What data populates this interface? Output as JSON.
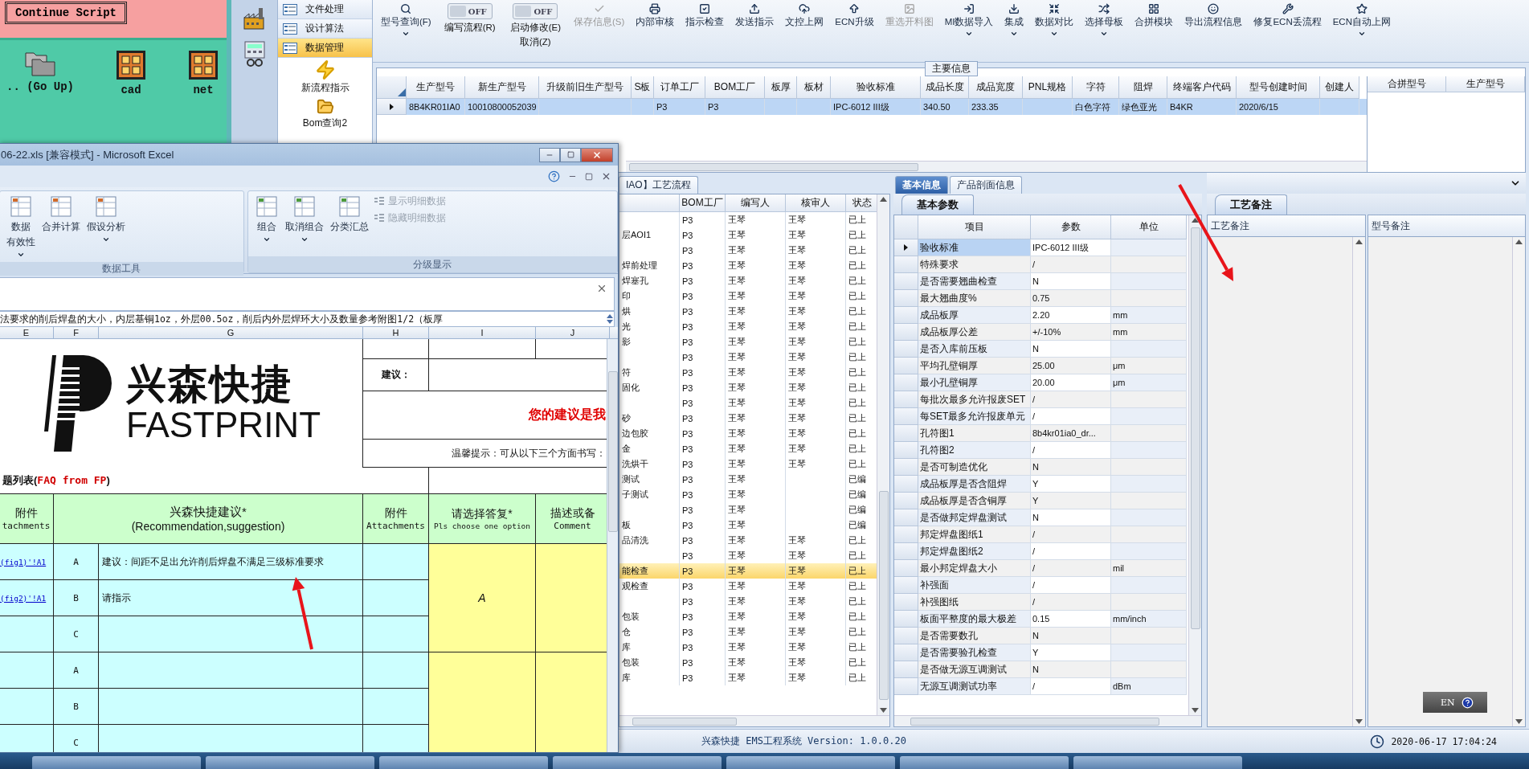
{
  "file_panel": {
    "button": "Continue Script",
    "items": [
      {
        "label": ".. (Go Up)",
        "kind": "folder"
      },
      {
        "label": "cad",
        "kind": "app"
      },
      {
        "label": "net",
        "kind": "app"
      }
    ]
  },
  "ems": {
    "nav": [
      {
        "label": "文件处理",
        "kind": "list",
        "selected": false
      },
      {
        "label": "设计算法",
        "kind": "list",
        "selected": false
      },
      {
        "label": "数据管理",
        "kind": "list",
        "selected": true
      },
      {
        "label": "新流程指示",
        "kind": "bolt",
        "selected": false
      },
      {
        "label": "Bom查询2",
        "kind": "folder",
        "selected": false
      }
    ],
    "toolbar": [
      {
        "kind": "button",
        "label": "型号查询(F)",
        "dropdown": true,
        "disabled": false
      },
      {
        "kind": "toggle",
        "label": "编写流程(R)",
        "state": "OFF",
        "on": false
      },
      {
        "kind": "toggle",
        "label": "启动修改(E)",
        "sublabel": "取消(Z)",
        "state": "OFF",
        "on": false
      },
      {
        "kind": "button",
        "label": "保存信息(S)",
        "dropdown": false,
        "disabled": true
      },
      {
        "kind": "button",
        "label": "内部审核",
        "dropdown": false,
        "disabled": false
      },
      {
        "kind": "button",
        "label": "指示检查",
        "dropdown": false,
        "disabled": false
      },
      {
        "kind": "button",
        "label": "发送指示",
        "dropdown": false,
        "disabled": false
      },
      {
        "kind": "button",
        "label": "文控上网",
        "dropdown": false,
        "disabled": false
      },
      {
        "kind": "button",
        "label": "ECN升级",
        "dropdown": false,
        "disabled": false
      },
      {
        "kind": "button",
        "label": "重选开料图",
        "dropdown": false,
        "disabled": true
      },
      {
        "kind": "button",
        "label": "MI数据导入",
        "dropdown": true,
        "disabled": false
      },
      {
        "kind": "button",
        "label": "集成",
        "dropdown": true,
        "disabled": false
      },
      {
        "kind": "button",
        "label": "数据对比",
        "dropdown": true,
        "disabled": false
      },
      {
        "kind": "button",
        "label": "选择母板",
        "dropdown": true,
        "disabled": false
      },
      {
        "kind": "button",
        "label": "合拼模块",
        "dropdown": false,
        "disabled": false
      },
      {
        "kind": "button",
        "label": "导出流程信息",
        "dropdown": false,
        "disabled": false
      },
      {
        "kind": "button",
        "label": "修复ECN丢流程",
        "dropdown": false,
        "disabled": false
      },
      {
        "kind": "button",
        "label": "ECN自动上网",
        "dropdown": true,
        "disabled": false
      }
    ],
    "main_info": {
      "title": "主要信息",
      "columns": [
        "生产型号",
        "新生产型号",
        "升级前旧生产型号",
        "S板",
        "订单工厂",
        "BOM工厂",
        "板厚",
        "板材",
        "验收标准",
        "成品长度",
        "成品宽度",
        "PNL规格",
        "字符",
        "阻焊",
        "终端客户代码",
        "型号创建时间",
        "创建人"
      ],
      "rows": [
        {
          "selected": true,
          "cells": [
            "8B4KR01IA0",
            "10010800052039",
            "",
            "",
            "P3",
            "P3",
            "",
            "",
            "IPC-6012 III级",
            "340.50",
            "233.35",
            "",
            "白色字符",
            "绿色亚光",
            "B4KR",
            "2020/6/15",
            ""
          ]
        }
      ],
      "side_columns": [
        "合拼型号",
        "生产型号"
      ]
    },
    "process": {
      "tab": "IAO】工艺流程",
      "columns": [
        "BOM工厂",
        "编写人",
        "核审人",
        "状态"
      ],
      "rows": [
        {
          "step": "",
          "factory": "P3",
          "writer": "王琴",
          "reviewer": "王琴",
          "status": "已上",
          "selected": false
        },
        {
          "step": "层AOI1",
          "factory": "P3",
          "writer": "王琴",
          "reviewer": "王琴",
          "status": "已上",
          "selected": false
        },
        {
          "step": "",
          "factory": "P3",
          "writer": "王琴",
          "reviewer": "王琴",
          "status": "已上",
          "selected": false
        },
        {
          "step": "焊前处理",
          "factory": "P3",
          "writer": "王琴",
          "reviewer": "王琴",
          "status": "已上",
          "selected": false
        },
        {
          "step": "焊塞孔",
          "factory": "P3",
          "writer": "王琴",
          "reviewer": "王琴",
          "status": "已上",
          "selected": false
        },
        {
          "step": "印",
          "factory": "P3",
          "writer": "王琴",
          "reviewer": "王琴",
          "status": "已上",
          "selected": false
        },
        {
          "step": "烘",
          "factory": "P3",
          "writer": "王琴",
          "reviewer": "王琴",
          "status": "已上",
          "selected": false
        },
        {
          "step": "光",
          "factory": "P3",
          "writer": "王琴",
          "reviewer": "王琴",
          "status": "已上",
          "selected": false
        },
        {
          "step": "影",
          "factory": "P3",
          "writer": "王琴",
          "reviewer": "王琴",
          "status": "已上",
          "selected": false
        },
        {
          "step": "",
          "factory": "P3",
          "writer": "王琴",
          "reviewer": "王琴",
          "status": "已上",
          "selected": false
        },
        {
          "step": "符",
          "factory": "P3",
          "writer": "王琴",
          "reviewer": "王琴",
          "status": "已上",
          "selected": false
        },
        {
          "step": "固化",
          "factory": "P3",
          "writer": "王琴",
          "reviewer": "王琴",
          "status": "已上",
          "selected": false
        },
        {
          "step": "",
          "factory": "P3",
          "writer": "王琴",
          "reviewer": "王琴",
          "status": "已上",
          "selected": false
        },
        {
          "step": "砂",
          "factory": "P3",
          "writer": "王琴",
          "reviewer": "王琴",
          "status": "已上",
          "selected": false
        },
        {
          "step": "边包胶",
          "factory": "P3",
          "writer": "王琴",
          "reviewer": "王琴",
          "status": "已上",
          "selected": false
        },
        {
          "step": "金",
          "factory": "P3",
          "writer": "王琴",
          "reviewer": "王琴",
          "status": "已上",
          "selected": false
        },
        {
          "step": "洗烘干",
          "factory": "P3",
          "writer": "王琴",
          "reviewer": "王琴",
          "status": "已上",
          "selected": false
        },
        {
          "step": "测试",
          "factory": "P3",
          "writer": "王琴",
          "reviewer": "",
          "status": "已编",
          "selected": false
        },
        {
          "step": "子测试",
          "factory": "P3",
          "writer": "王琴",
          "reviewer": "",
          "status": "已编",
          "selected": false
        },
        {
          "step": "",
          "factory": "P3",
          "writer": "王琴",
          "reviewer": "",
          "status": "已编",
          "selected": false
        },
        {
          "step": "板",
          "factory": "P3",
          "writer": "王琴",
          "reviewer": "",
          "status": "已编",
          "selected": false
        },
        {
          "step": "品清洗",
          "factory": "P3",
          "writer": "王琴",
          "reviewer": "王琴",
          "status": "已上",
          "selected": false
        },
        {
          "step": "",
          "factory": "P3",
          "writer": "王琴",
          "reviewer": "王琴",
          "status": "已上",
          "selected": false
        },
        {
          "step": "能检查",
          "factory": "P3",
          "writer": "王琴",
          "reviewer": "王琴",
          "status": "已上",
          "selected": true
        },
        {
          "step": "观检查",
          "factory": "P3",
          "writer": "王琴",
          "reviewer": "王琴",
          "status": "已上",
          "selected": false
        },
        {
          "step": "",
          "factory": "P3",
          "writer": "王琴",
          "reviewer": "王琴",
          "status": "已上",
          "selected": false
        },
        {
          "step": "包装",
          "factory": "P3",
          "writer": "王琴",
          "reviewer": "王琴",
          "status": "已上",
          "selected": false
        },
        {
          "step": "仓",
          "factory": "P3",
          "writer": "王琴",
          "reviewer": "王琴",
          "status": "已上",
          "selected": false
        },
        {
          "step": "库",
          "factory": "P3",
          "writer": "王琴",
          "reviewer": "王琴",
          "status": "已上",
          "selected": false
        },
        {
          "step": "包装",
          "factory": "P3",
          "writer": "王琴",
          "reviewer": "王琴",
          "status": "已上",
          "selected": false
        },
        {
          "step": "库",
          "factory": "P3",
          "writer": "王琴",
          "reviewer": "王琴",
          "status": "已上",
          "selected": false
        }
      ]
    },
    "params": {
      "tabs": [
        {
          "label": "基本信息",
          "selected": true
        },
        {
          "label": "产品剖面信息",
          "selected": false
        }
      ],
      "subtab": "基本参数",
      "columns": [
        "项目",
        "参数",
        "单位"
      ],
      "rows": [
        {
          "item": "验收标准",
          "value": "IPC-6012 III级",
          "unit": "",
          "selected": true
        },
        {
          "item": "特殊要求",
          "value": "/",
          "unit": "",
          "selected": false
        },
        {
          "item": "是否需要翘曲检查",
          "value": "N",
          "unit": "",
          "selected": false
        },
        {
          "item": "最大翘曲度%",
          "value": "0.75",
          "unit": "",
          "selected": false
        },
        {
          "item": "成品板厚",
          "value": "2.20",
          "unit": "mm",
          "selected": false
        },
        {
          "item": "成品板厚公差",
          "value": "+/-10%",
          "unit": "mm",
          "selected": false
        },
        {
          "item": "是否入库前压板",
          "value": "N",
          "unit": "",
          "selected": false
        },
        {
          "item": "平均孔壁铜厚",
          "value": "25.00",
          "unit": "μm",
          "selected": false
        },
        {
          "item": "最小孔壁铜厚",
          "value": "20.00",
          "unit": "μm",
          "selected": false
        },
        {
          "item": "每批次最多允许报废SET",
          "value": "/",
          "unit": "",
          "selected": false
        },
        {
          "item": "每SET最多允许报废单元",
          "value": "/",
          "unit": "",
          "selected": false
        },
        {
          "item": "孔符图1",
          "value": "8b4kr01ia0_dr...",
          "unit": "",
          "selected": false
        },
        {
          "item": "孔符图2",
          "value": "/",
          "unit": "",
          "selected": false
        },
        {
          "item": "是否可制造优化",
          "value": "N",
          "unit": "",
          "selected": false
        },
        {
          "item": "成品板厚是否含阻焊",
          "value": "Y",
          "unit": "",
          "selected": false
        },
        {
          "item": "成品板厚是否含铜厚",
          "value": "Y",
          "unit": "",
          "selected": false
        },
        {
          "item": "是否做邦定焊盘测试",
          "value": "N",
          "unit": "",
          "selected": false
        },
        {
          "item": "邦定焊盘图纸1",
          "value": "/",
          "unit": "",
          "selected": false
        },
        {
          "item": "邦定焊盘图纸2",
          "value": "/",
          "unit": "",
          "selected": false
        },
        {
          "item": "最小邦定焊盘大小",
          "value": "/",
          "unit": "mil",
          "selected": false
        },
        {
          "item": "补强面",
          "value": "/",
          "unit": "",
          "selected": false
        },
        {
          "item": "补强图纸",
          "value": "/",
          "unit": "",
          "selected": false
        },
        {
          "item": "板面平整度的最大极差",
          "value": "0.15",
          "unit": "mm/inch",
          "selected": false
        },
        {
          "item": "是否需要数孔",
          "value": "N",
          "unit": "",
          "selected": false
        },
        {
          "item": "是否需要验孔检查",
          "value": "Y",
          "unit": "",
          "selected": false
        },
        {
          "item": "是否做无源互调测试",
          "value": "N",
          "unit": "",
          "selected": false
        },
        {
          "item": "无源互调测试功率",
          "value": "/",
          "unit": "dBm",
          "selected": false
        }
      ]
    },
    "notes": {
      "tab": "工艺备注",
      "columns": [
        "工艺备注",
        "型号备注"
      ],
      "ime": "EN"
    },
    "status": {
      "text": "兴森快捷 EMS工程系统 Version: 1.0.0.20",
      "time": "2020-06-17 17:04:24"
    }
  },
  "excel": {
    "title": "06-22.xls [兼容模式] - Microsoft Excel",
    "groups": [
      {
        "title": "数据工具",
        "items": [
          {
            "label": "数据",
            "label2": "有效性",
            "dropdown": true
          },
          {
            "label": "合并计算",
            "dropdown": false
          },
          {
            "label": "假设分析",
            "dropdown": true
          }
        ]
      },
      {
        "title": "分级显示",
        "items": [
          {
            "label": "组合",
            "dropdown": true
          },
          {
            "label": "取消组合",
            "dropdown": true
          },
          {
            "label": "分类汇总",
            "dropdown": false
          }
        ],
        "small": [
          {
            "label": "显示明细数据",
            "disabled": true
          },
          {
            "label": "隐藏明细数据",
            "disabled": true
          }
        ]
      }
    ],
    "formula": "法要求的削后焊盘的大小，内层基铜1oz，外层00.5oz，削后内外层焊环大小及数量参考附图1/2（板厚",
    "columns": [
      "E",
      "F",
      "G",
      "H",
      "I",
      "J"
    ],
    "logo": {
      "cn": "兴森快捷",
      "en": "FASTPRINT"
    },
    "suggest_label": "建议：",
    "slogan": "您的建议是我",
    "tip": "温馨提示：可从以下三个方面书写：",
    "list_title": "题列表(**FAQ from FP**)",
    "headers": [
      {
        "cn": "附件",
        "en": "tachments"
      },
      {
        "cn": "兴森快捷建议*",
        "en": "(Recommendation,suggestion)"
      },
      {
        "cn": "附件",
        "en": "Attachments"
      },
      {
        "cn": "请选择答复*",
        "en": "Pls choose one option"
      },
      {
        "cn": "描述或备",
        "en": "Comment"
      }
    ],
    "rows": [
      {
        "link": "(fig1)'!A1",
        "option": "A",
        "text": "建议：间距不足出允许削后焊盘不满足三级标准要求"
      },
      {
        "link": "(fig2)'!A1",
        "option": "B",
        "text": "请指示"
      },
      {
        "option": "C"
      },
      {
        "option": "A"
      },
      {
        "option": "B"
      },
      {
        "option": "C"
      }
    ],
    "answer": "A"
  }
}
